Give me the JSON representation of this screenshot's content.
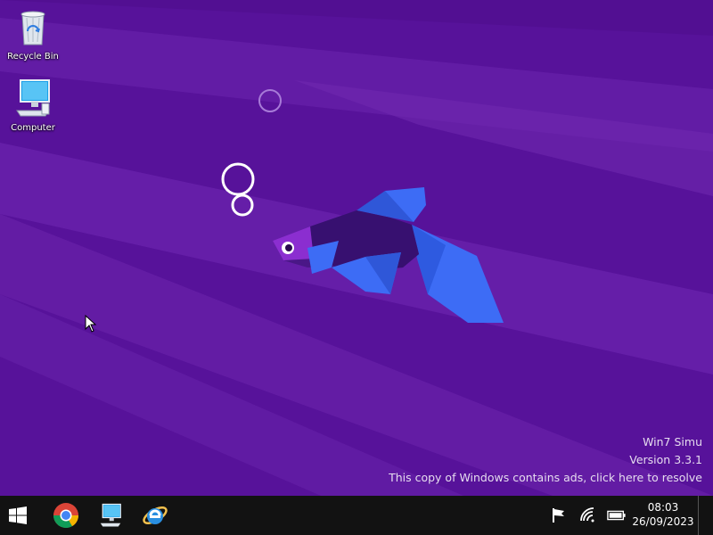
{
  "desktop": {
    "icons": [
      {
        "label": "Recycle Bin",
        "icon": "recycle-bin-icon"
      },
      {
        "label": "Computer",
        "icon": "computer-icon"
      }
    ],
    "watermark": {
      "line1": "Win7 Simu",
      "line2": "Version 3.3.1",
      "line3": "This copy of Windows contains ads, click here to resolve"
    }
  },
  "taskbar": {
    "start_icon": "windows-logo-icon",
    "pinned_apps": [
      "chrome-icon",
      "computer-icon",
      "internet-explorer-icon"
    ],
    "tray": {
      "icons": [
        "action-center-flag-icon",
        "wifi-icon",
        "battery-icon"
      ],
      "time": "08:03",
      "date": "26/09/2023"
    }
  },
  "colors": {
    "desktop_bg": "#5a0f9a",
    "taskbar_bg": "#121212",
    "fish_blue": "#3d6cf5"
  }
}
